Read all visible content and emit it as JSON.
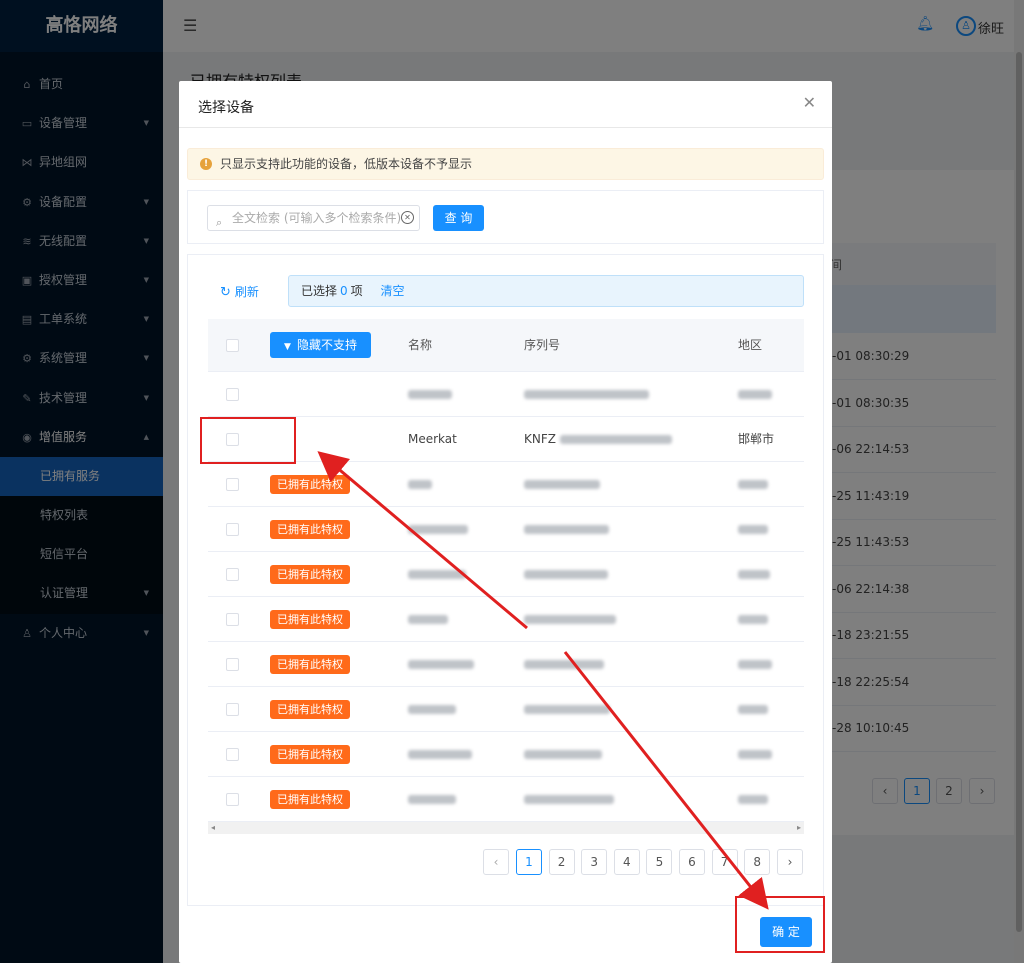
{
  "app": {
    "logo": "高恪网络"
  },
  "sidebar": {
    "items": [
      {
        "label": "首页",
        "icon": "home-icon",
        "glyph": "⌂",
        "chevron": ""
      },
      {
        "label": "设备管理",
        "icon": "monitor-icon",
        "glyph": "▭",
        "chevron": "⌄"
      },
      {
        "label": "异地组网",
        "icon": "network-icon",
        "glyph": "⋈",
        "chevron": ""
      },
      {
        "label": "设备配置",
        "icon": "gear-icon",
        "glyph": "⚙",
        "chevron": "⌄"
      },
      {
        "label": "无线配置",
        "icon": "wifi-icon",
        "glyph": "≋",
        "chevron": "⌄"
      },
      {
        "label": "授权管理",
        "icon": "id-card-icon",
        "glyph": "▣",
        "chevron": "⌄"
      },
      {
        "label": "工单系统",
        "icon": "ticket-icon",
        "glyph": "▤",
        "chevron": "⌄"
      },
      {
        "label": "系统管理",
        "icon": "settings-icon",
        "glyph": "⚙",
        "chevron": "⌄"
      },
      {
        "label": "技术管理",
        "icon": "wrench-icon",
        "glyph": "✎",
        "chevron": "⌄"
      },
      {
        "label": "增值服务",
        "icon": "value-added-icon",
        "glyph": "◉",
        "chevron": "⌃"
      },
      {
        "label": "已拥有服务",
        "sub": true,
        "active": true
      },
      {
        "label": "特权列表",
        "sub": true
      },
      {
        "label": "短信平台",
        "sub": true
      },
      {
        "label": "认证管理",
        "sub": true,
        "chevron": "⌄"
      },
      {
        "label": "个人中心",
        "icon": "user-icon",
        "glyph": "♙",
        "chevron": "⌄"
      }
    ]
  },
  "header": {
    "user_name": "徐旺"
  },
  "page": {
    "title": "已拥有特权列表",
    "bg_column": "间",
    "bg_times": [
      "-01  08:30:29",
      "-01  08:30:35",
      "-06  22:14:53",
      "-25  11:43:19",
      "-25  11:43:53",
      "-06  22:14:38",
      "-18  23:21:55",
      "-18  22:25:54",
      "-28  10:10:45"
    ],
    "bg_pages": [
      "1",
      "2"
    ]
  },
  "modal": {
    "title": "选择设备",
    "notice": "只显示支持此功能的设备，低版本设备不予显示",
    "search_placeholder": "全文检索 (可输入多个检索条件)",
    "query_button": "查 询",
    "refresh_label": "刷新",
    "selected_prefix": "已选择",
    "selected_count": "0",
    "selected_suffix": "项",
    "clear_label": "清空",
    "hide_unsupported": "隐藏不支持",
    "columns": {
      "name": "名称",
      "serial": "序列号",
      "region": "地区"
    },
    "rows": [
      {
        "tag": "",
        "name": "",
        "serial": "",
        "region": ""
      },
      {
        "tag": "",
        "name": "Meerkat",
        "serial": "KNFZ",
        "region": "邯郸市"
      },
      {
        "tag": "已拥有此特权",
        "name": "",
        "serial": "",
        "region": ""
      },
      {
        "tag": "已拥有此特权",
        "name": "",
        "serial": "",
        "region": ""
      },
      {
        "tag": "已拥有此特权",
        "name": "",
        "serial": "",
        "region": ""
      },
      {
        "tag": "已拥有此特权",
        "name": "",
        "serial": "",
        "region": ""
      },
      {
        "tag": "已拥有此特权",
        "name": "",
        "serial": "",
        "region": ""
      },
      {
        "tag": "已拥有此特权",
        "name": "",
        "serial": "",
        "region": ""
      },
      {
        "tag": "已拥有此特权",
        "name": "",
        "serial": "",
        "region": ""
      },
      {
        "tag": "已拥有此特权",
        "name": "",
        "serial": "",
        "region": ""
      }
    ],
    "pages": [
      "1",
      "2",
      "3",
      "4",
      "5",
      "6",
      "7",
      "8"
    ],
    "current_page": "1",
    "confirm_button": "确 定"
  },
  "colors": {
    "primary": "#1890ff",
    "sidebar_bg": "#001529",
    "tag": "#ff6a1a",
    "annotation": "#e02020"
  }
}
